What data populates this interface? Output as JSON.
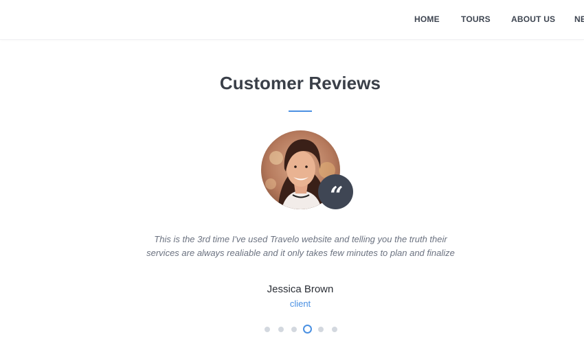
{
  "nav": {
    "items": [
      "HOME",
      "TOURS",
      "ABOUT US",
      "NEWS"
    ]
  },
  "reviews": {
    "title": "Customer Reviews",
    "accent_color": "#4a90e2",
    "quote_icon": "quote-icon",
    "text": "This is the 3rd time I've used Travelo website and telling you the truth their services are always realiable and it only takes few minutes to plan and finalize",
    "name": "Jessica Brown",
    "role": "client",
    "carousel": {
      "count": 6,
      "active_index": 4
    }
  }
}
